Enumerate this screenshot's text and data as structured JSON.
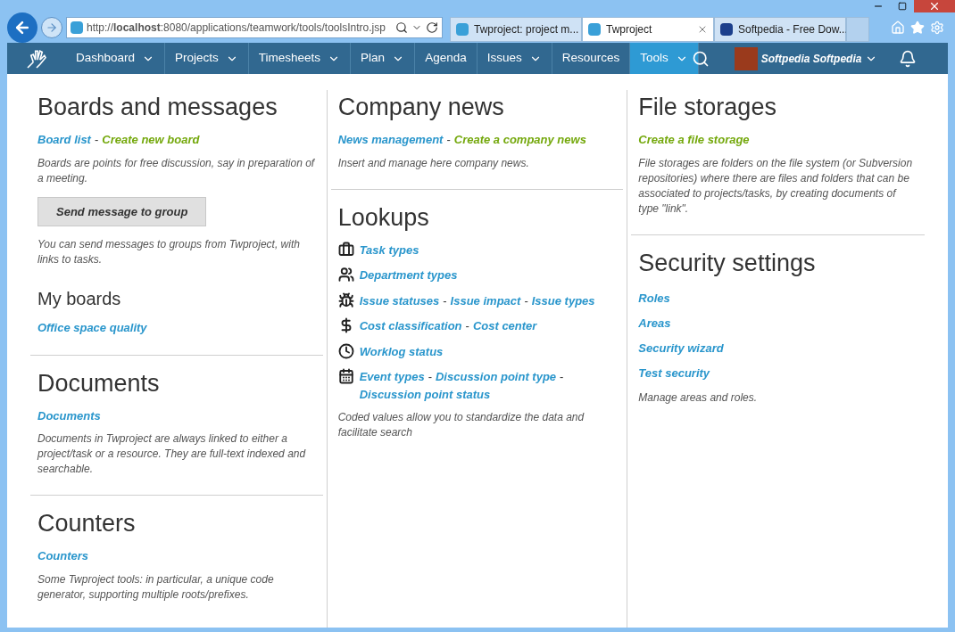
{
  "browser": {
    "address": "http://**localhost**:8080/applications/teamwork/tools/toolsIntro.jsp",
    "tabs": [
      {
        "title": "Twproject: project m...",
        "selected": false
      },
      {
        "title": "Twproject",
        "selected": true
      },
      {
        "title": "Softpedia - Free Dow...",
        "selected": false
      }
    ]
  },
  "nav": {
    "items": [
      {
        "label": "Dashboard",
        "dropdown": true,
        "selected": false
      },
      {
        "label": "Projects",
        "dropdown": true,
        "selected": false
      },
      {
        "label": "Timesheets",
        "dropdown": true,
        "selected": false
      },
      {
        "label": "Plan",
        "dropdown": true,
        "selected": false
      },
      {
        "label": "Agenda",
        "dropdown": false,
        "selected": false
      },
      {
        "label": "Issues",
        "dropdown": true,
        "selected": false
      },
      {
        "label": "Resources",
        "dropdown": false,
        "selected": false
      },
      {
        "label": "Tools",
        "dropdown": true,
        "selected": true
      }
    ],
    "user": "Softpedia Softpedia"
  },
  "columns": [
    [
      {
        "title": "Boards and messages",
        "blocks": [
          {
            "kind": "links",
            "separator": "-",
            "links": [
              {
                "label": "Board list",
                "kind": "view"
              },
              {
                "label": "Create new board",
                "kind": "create"
              }
            ]
          },
          {
            "kind": "text",
            "text": "Boards are points for free discussion, say in preparation of a meeting."
          },
          {
            "kind": "button",
            "text": "Send message to group"
          },
          {
            "kind": "text",
            "text": "You can send messages to groups from Twproject, with links to tasks."
          },
          {
            "kind": "subtitle",
            "text": "My boards"
          },
          {
            "kind": "links",
            "links": [
              {
                "label": "Office space quality",
                "kind": "view"
              }
            ]
          }
        ]
      },
      {
        "title": "Documents",
        "blocks": [
          {
            "kind": "links",
            "links": [
              {
                "label": "Documents",
                "kind": "view"
              }
            ]
          },
          {
            "kind": "text",
            "text": "Documents in Twproject are always linked to either a project/task or a resource. They are full-text indexed and searchable."
          }
        ]
      },
      {
        "title": "Counters",
        "blocks": [
          {
            "kind": "links",
            "links": [
              {
                "label": "Counters",
                "kind": "view"
              }
            ]
          },
          {
            "kind": "text",
            "text": "Some Twproject tools: in particular, a unique code generator, supporting multiple roots/prefixes."
          }
        ]
      }
    ],
    [
      {
        "title": "Company news",
        "blocks": [
          {
            "kind": "links",
            "separator": "-",
            "links": [
              {
                "label": "News management",
                "kind": "view"
              },
              {
                "label": "Create a company news",
                "kind": "create"
              }
            ]
          },
          {
            "kind": "text",
            "text": "Insert and manage here company news."
          }
        ]
      },
      {
        "title": "Lookups",
        "blocks": [
          {
            "kind": "lookups",
            "rows": [
              {
                "kind": "briefcase",
                "links": [
                  {
                    "label": "Task types",
                    "kind": "view"
                  }
                ]
              },
              {
                "kind": "people",
                "links": [
                  {
                    "label": "Department types",
                    "kind": "view"
                  }
                ]
              },
              {
                "kind": "bug",
                "separator": "-",
                "links": [
                  {
                    "label": "Issue statuses",
                    "kind": "view"
                  },
                  {
                    "label": "Issue impact",
                    "kind": "view"
                  },
                  {
                    "label": "Issue types",
                    "kind": "view"
                  }
                ]
              },
              {
                "kind": "dollar",
                "separator": "-",
                "links": [
                  {
                    "label": "Cost classification",
                    "kind": "view"
                  },
                  {
                    "label": "Cost center",
                    "kind": "view"
                  }
                ]
              },
              {
                "kind": "clock",
                "links": [
                  {
                    "label": "Worklog status",
                    "kind": "view"
                  }
                ]
              },
              {
                "kind": "calendar",
                "separator": "-",
                "links": [
                  {
                    "label": "Event types",
                    "kind": "view"
                  },
                  {
                    "label": "Discussion point type",
                    "kind": "view"
                  },
                  {
                    "label": "Discussion point status",
                    "kind": "view"
                  }
                ]
              }
            ]
          },
          {
            "kind": "text",
            "text": "Coded values allow you to standardize the data and facilitate search"
          }
        ]
      }
    ],
    [
      {
        "title": "File storages",
        "blocks": [
          {
            "kind": "links",
            "links": [
              {
                "label": "Create a file storage",
                "kind": "create"
              }
            ]
          },
          {
            "kind": "text",
            "text": "File storages are folders on the file system (or Subversion repositories) where there are files and folders that can be associated to projects/tasks, by creating documents of type \"link\"."
          }
        ]
      },
      {
        "title": "Security settings",
        "blocks": [
          {
            "kind": "stack",
            "links": [
              {
                "label": "Roles",
                "kind": "view"
              },
              {
                "label": "Areas",
                "kind": "view"
              },
              {
                "label": "Security wizard",
                "kind": "view"
              },
              {
                "label": "Test security",
                "kind": "view"
              }
            ]
          },
          {
            "kind": "text",
            "text": "Manage areas and roles."
          }
        ]
      }
    ]
  ]
}
